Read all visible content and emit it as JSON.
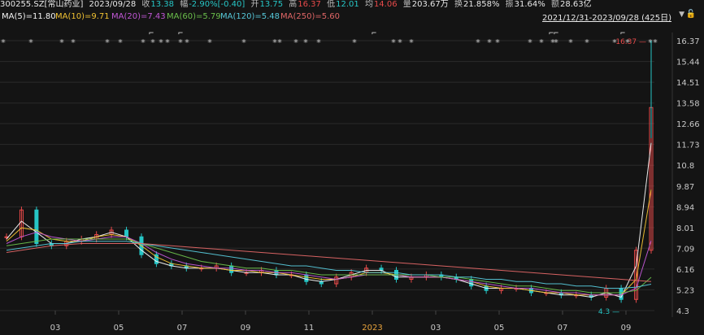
{
  "header": {
    "code": "300255.SZ[常山药业]",
    "date": "2023/09/28",
    "close_label": "收",
    "close": "13.38",
    "change_label": "幅",
    "change": "-2.90%[-0.40]",
    "open_label": "开",
    "open": "13.75",
    "high_label": "高",
    "high": "16.37",
    "low_label": "低",
    "low": "12.01",
    "avg_label": "均",
    "avg": "14.06",
    "volume_label": "量",
    "volume": "203.67万",
    "turnover_label": "换",
    "turnover": "21.858%",
    "amplitude_label": "振",
    "amplitude": "31.64%",
    "amount_label": "额",
    "amount": "28.63亿"
  },
  "ma_legend": [
    {
      "label": "MA(5)=11.80",
      "color": "#f5f5f5"
    },
    {
      "label": "MA(10)=9.71",
      "color": "#f1c232"
    },
    {
      "label": "MA(20)=7.43",
      "color": "#c157d6"
    },
    {
      "label": "MA(60)=5.79",
      "color": "#6abf4b"
    },
    {
      "label": "MA(120)=5.48",
      "color": "#56c7d8"
    },
    {
      "label": "MA(250)=5.60",
      "color": "#e06666"
    }
  ],
  "range_label": "2021/12/31-2023/09/28 (425日)",
  "colors": {
    "up": "#e84a4a",
    "down": "#26c6c6",
    "grid": "#2a2a2a",
    "axis_text": "#c8c8c8"
  },
  "icons": {
    "dropdown": "triangle-down-icon",
    "lock": "lock-icon"
  },
  "chart_data": {
    "type": "candlestick",
    "title": "",
    "ylim": [
      4.3,
      16.37
    ],
    "y_ticks": [
      "16.37",
      "15.44",
      "14.51",
      "13.58",
      "12.66",
      "11.73",
      "10.8",
      "9.87",
      "8.94",
      "8.01",
      "7.09",
      "6.16",
      "5.23",
      "4.3"
    ],
    "x_ticks": [
      "03",
      "05",
      "07",
      "09",
      "11",
      "2023",
      "03",
      "05",
      "07",
      "09"
    ],
    "highlight_tick": "2023",
    "annotations": [
      {
        "text": "16.37",
        "value": 16.37
      },
      {
        "text": "4.3",
        "value": 4.3
      }
    ],
    "series": [
      {
        "name": "K",
        "values": [
          7.6,
          8.8,
          7.3,
          7.2,
          7.4,
          7.5,
          7.7,
          7.9,
          7.6,
          6.8,
          6.4,
          6.3,
          6.2,
          6.2,
          6.3,
          6.0,
          6.0,
          6.1,
          5.9,
          5.9,
          5.6,
          5.5,
          5.8,
          6.0,
          6.2,
          6.1,
          5.7,
          5.8,
          5.9,
          5.8,
          5.7,
          5.4,
          5.2,
          5.3,
          5.3,
          5.1,
          5.1,
          5.0,
          5.0,
          4.9,
          5.3,
          4.8,
          7.0,
          13.38
        ]
      },
      {
        "name": "MA(5)",
        "values": [
          7.5,
          8.3,
          7.8,
          7.3,
          7.3,
          7.5,
          7.6,
          7.8,
          7.6,
          7.0,
          6.5,
          6.3,
          6.2,
          6.2,
          6.2,
          6.1,
          6.0,
          6.0,
          5.9,
          5.9,
          5.7,
          5.6,
          5.7,
          5.9,
          6.1,
          6.1,
          5.8,
          5.8,
          5.8,
          5.8,
          5.7,
          5.5,
          5.3,
          5.3,
          5.3,
          5.2,
          5.1,
          5.0,
          5.0,
          4.9,
          5.1,
          4.9,
          6.3,
          11.8
        ]
      },
      {
        "name": "MA(10)",
        "values": [
          7.4,
          8.0,
          7.9,
          7.5,
          7.4,
          7.4,
          7.6,
          7.7,
          7.6,
          7.2,
          6.7,
          6.4,
          6.3,
          6.2,
          6.2,
          6.1,
          6.1,
          6.0,
          6.0,
          5.9,
          5.8,
          5.7,
          5.7,
          5.8,
          6.0,
          6.0,
          5.9,
          5.8,
          5.8,
          5.8,
          5.7,
          5.6,
          5.4,
          5.3,
          5.3,
          5.2,
          5.1,
          5.1,
          5.0,
          5.0,
          5.0,
          5.0,
          5.7,
          9.71
        ]
      },
      {
        "name": "MA(20)",
        "values": [
          7.3,
          7.6,
          7.8,
          7.6,
          7.5,
          7.4,
          7.5,
          7.6,
          7.6,
          7.3,
          6.9,
          6.6,
          6.4,
          6.3,
          6.2,
          6.2,
          6.1,
          6.1,
          6.0,
          6.0,
          5.9,
          5.8,
          5.7,
          5.8,
          5.9,
          5.9,
          5.9,
          5.8,
          5.8,
          5.8,
          5.7,
          5.6,
          5.5,
          5.4,
          5.3,
          5.3,
          5.2,
          5.1,
          5.1,
          5.0,
          5.0,
          5.0,
          5.3,
          7.43
        ]
      },
      {
        "name": "MA(60)",
        "values": [
          7.2,
          7.3,
          7.4,
          7.5,
          7.5,
          7.5,
          7.5,
          7.5,
          7.5,
          7.3,
          7.1,
          6.9,
          6.7,
          6.5,
          6.4,
          6.3,
          6.2,
          6.2,
          6.1,
          6.1,
          6.0,
          5.9,
          5.9,
          5.9,
          5.9,
          5.9,
          5.9,
          5.9,
          5.9,
          5.8,
          5.8,
          5.7,
          5.6,
          5.5,
          5.4,
          5.4,
          5.3,
          5.2,
          5.2,
          5.1,
          5.1,
          5.1,
          5.2,
          5.79
        ]
      },
      {
        "name": "MA(120)",
        "values": [
          7.0,
          7.1,
          7.2,
          7.3,
          7.3,
          7.4,
          7.4,
          7.4,
          7.4,
          7.3,
          7.2,
          7.1,
          7.0,
          6.9,
          6.8,
          6.7,
          6.6,
          6.5,
          6.4,
          6.3,
          6.3,
          6.2,
          6.1,
          6.1,
          6.0,
          6.0,
          6.0,
          5.9,
          5.9,
          5.9,
          5.8,
          5.8,
          5.7,
          5.7,
          5.6,
          5.6,
          5.5,
          5.5,
          5.4,
          5.4,
          5.3,
          5.3,
          5.35,
          5.48
        ]
      },
      {
        "name": "MA(250)",
        "values": [
          6.9,
          7.0,
          7.1,
          7.2,
          7.25,
          7.3,
          7.3,
          7.3,
          7.3,
          7.3,
          7.25,
          7.2,
          7.15,
          7.1,
          7.05,
          7.0,
          6.95,
          6.9,
          6.85,
          6.8,
          6.75,
          6.7,
          6.65,
          6.6,
          6.55,
          6.5,
          6.45,
          6.4,
          6.35,
          6.3,
          6.25,
          6.2,
          6.15,
          6.1,
          6.05,
          6.0,
          5.95,
          5.9,
          5.85,
          5.8,
          5.75,
          5.7,
          5.65,
          5.6
        ]
      }
    ],
    "star_markers": "*",
    "flag_markers": "⌐"
  }
}
